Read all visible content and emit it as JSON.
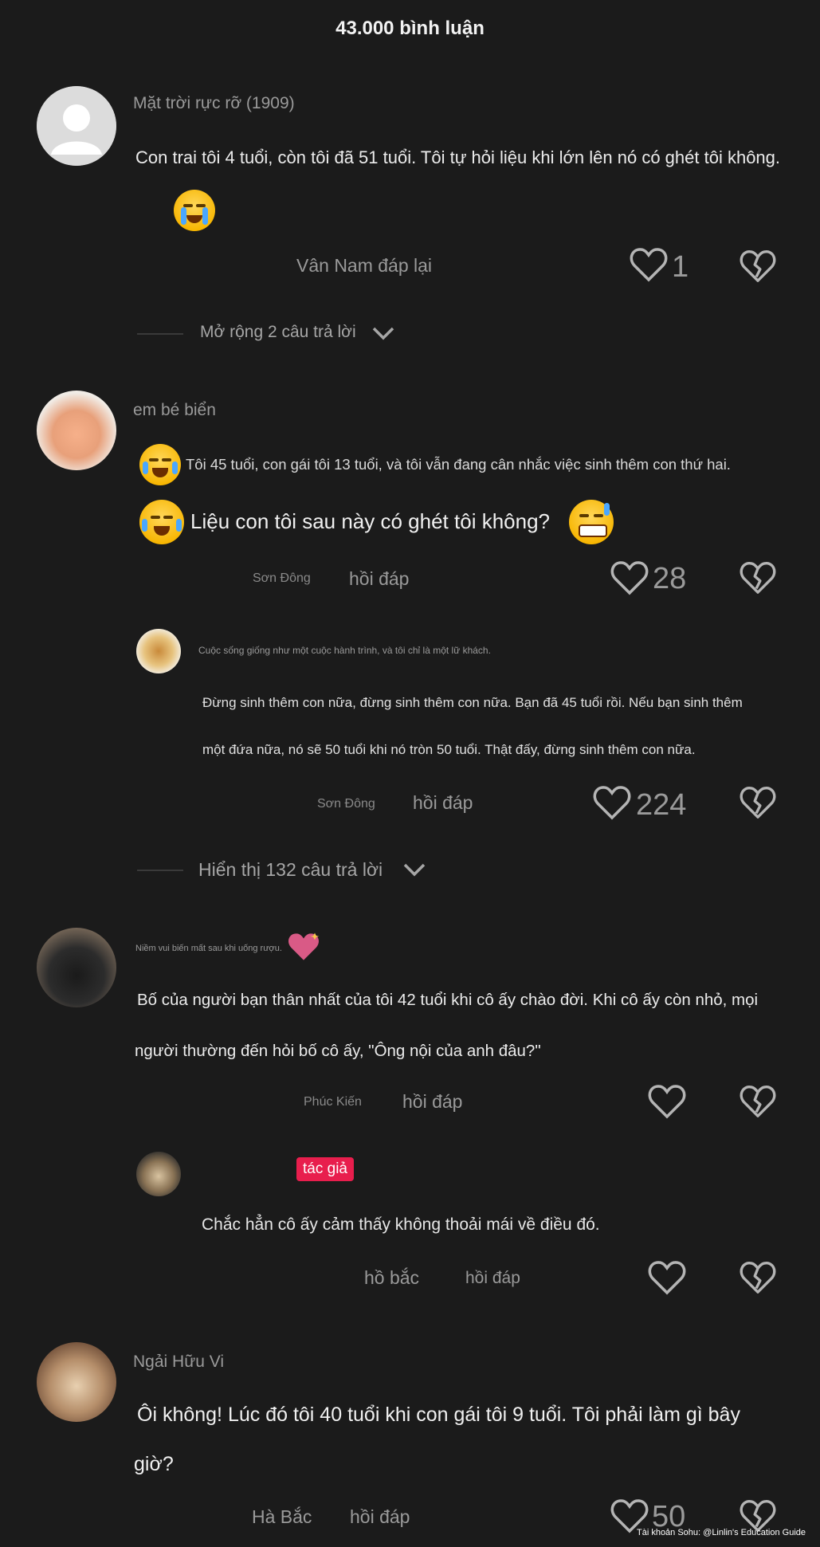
{
  "header": {
    "title": "43.000 bình luận"
  },
  "comments": [
    {
      "username": "Mặt trời rực rỡ (1909)",
      "text": "Con trai tôi 4 tuổi, còn tôi đã 51 tuổi. Tôi tự hỏi liệu khi lớn lên nó có ghét tôi không.",
      "reply_label": "Vân Nam đáp lại",
      "likes": "1",
      "expand": "Mở rộng 2 câu trả lời"
    },
    {
      "username": "em bé biển",
      "text_line1": "Tôi 45 tuổi, con gái tôi 13 tuổi, và tôi vẫn đang cân nhắc việc sinh thêm con thứ hai.",
      "text_line2": "Liệu con tôi sau này có ghét tôi không?",
      "location": "Sơn Đông",
      "reply_label": "hồi đáp",
      "likes": "28",
      "reply": {
        "username": "Cuộc sống giống như một cuộc hành trình, và tôi chỉ là một lữ khách.",
        "text_line1": "Đừng sinh thêm con nữa, đừng sinh thêm con nữa. Bạn đã 45 tuổi rồi. Nếu bạn sinh thêm",
        "text_line2": "một đứa nữa, nó sẽ 50 tuổi khi nó tròn 50 tuổi. Thật đấy, đừng sinh thêm con nữa.",
        "location": "Sơn Đông",
        "reply_label": "hồi đáp",
        "likes": "224"
      },
      "expand": "Hiển thị 132 câu trả lời"
    },
    {
      "username": "Niềm vui biến mất sau khi uống rượu.",
      "text_line1": "Bố của người bạn thân nhất của tôi 42 tuổi khi cô ấy chào đời. Khi cô ấy còn nhỏ, mọi",
      "text_line2": "người thường đến hỏi bố cô ấy, \"Ông nội của anh đâu?\"",
      "location": "Phúc Kiến",
      "reply_label": "hồi đáp",
      "reply": {
        "badge": "tác giả",
        "text": "Chắc hẳn cô ấy cảm thấy không thoải mái về điều đó.",
        "location": "hồ bắc",
        "reply_label": "hồi đáp"
      }
    },
    {
      "username": "Ngải Hữu Vi",
      "text_line1": "Ôi không! Lúc đó tôi 40 tuổi khi con gái tôi 9 tuổi. Tôi phải làm gì bây",
      "text_line2": "giờ?",
      "location": "Hà Bắc",
      "reply_label": "hồi đáp",
      "likes": "50"
    }
  ],
  "watermark": "Tài khoản Sohu: @Linlin's Education Guide",
  "colors": {
    "background": "#1b1b1b",
    "badge": "#e81e4d",
    "text": "#ececec",
    "muted": "#9a9a9a"
  }
}
